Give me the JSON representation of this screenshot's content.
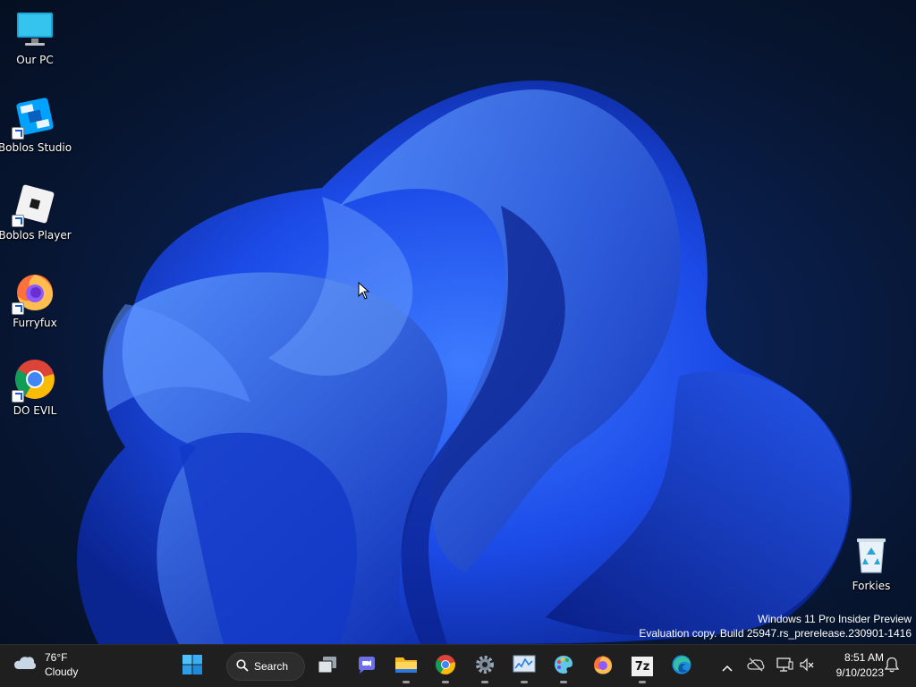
{
  "desktop": {
    "icons": [
      {
        "label": "Our PC",
        "icon": "monitor-icon"
      },
      {
        "label": "Boblos Studio",
        "icon": "boblos-studio-icon"
      },
      {
        "label": "Boblos Player",
        "icon": "boblos-player-icon"
      },
      {
        "label": "Furryfux",
        "icon": "firefox-icon"
      },
      {
        "label": "DO EVIL",
        "icon": "chrome-icon"
      },
      {
        "label": "Forkies",
        "icon": "recycle-bin-icon"
      }
    ],
    "watermark": {
      "line1": "Windows 11 Pro Insider Preview",
      "line2": "Evaluation copy. Build 25947.rs_prerelease.230901-1416"
    }
  },
  "taskbar": {
    "weather": {
      "temp": "76°F",
      "condition": "Cloudy",
      "icon": "cloud-icon"
    },
    "search_label": "Search",
    "pinned": [
      {
        "name": "start",
        "icon": "windows-logo-icon"
      },
      {
        "name": "search",
        "icon": "search-icon"
      },
      {
        "name": "task-view",
        "icon": "task-view-icon"
      },
      {
        "name": "chat",
        "icon": "chat-icon"
      },
      {
        "name": "file-explorer",
        "icon": "folder-icon"
      },
      {
        "name": "chrome",
        "icon": "chrome-icon"
      },
      {
        "name": "settings",
        "icon": "gear-icon"
      },
      {
        "name": "task-manager",
        "icon": "task-manager-icon"
      },
      {
        "name": "paint",
        "icon": "paint-icon"
      },
      {
        "name": "firefox",
        "icon": "firefox-icon"
      },
      {
        "name": "7zip",
        "icon": "7zip-icon"
      },
      {
        "name": "edge",
        "icon": "edge-icon"
      }
    ],
    "tray": {
      "chevron": "chevron-up-icon",
      "onedrive": "cloud-off-icon",
      "network": "network-icon",
      "volume": "volume-muted-icon",
      "notifications": "bell-icon"
    },
    "clock": {
      "time": "8:51 AM",
      "date": "9/10/2023"
    },
    "seven_zip_label": "7z"
  },
  "colors": {
    "taskbar_bg": "#1f1f1f",
    "accent": "#0067c0",
    "wallpaper_bloom": "#1a4fe0"
  }
}
